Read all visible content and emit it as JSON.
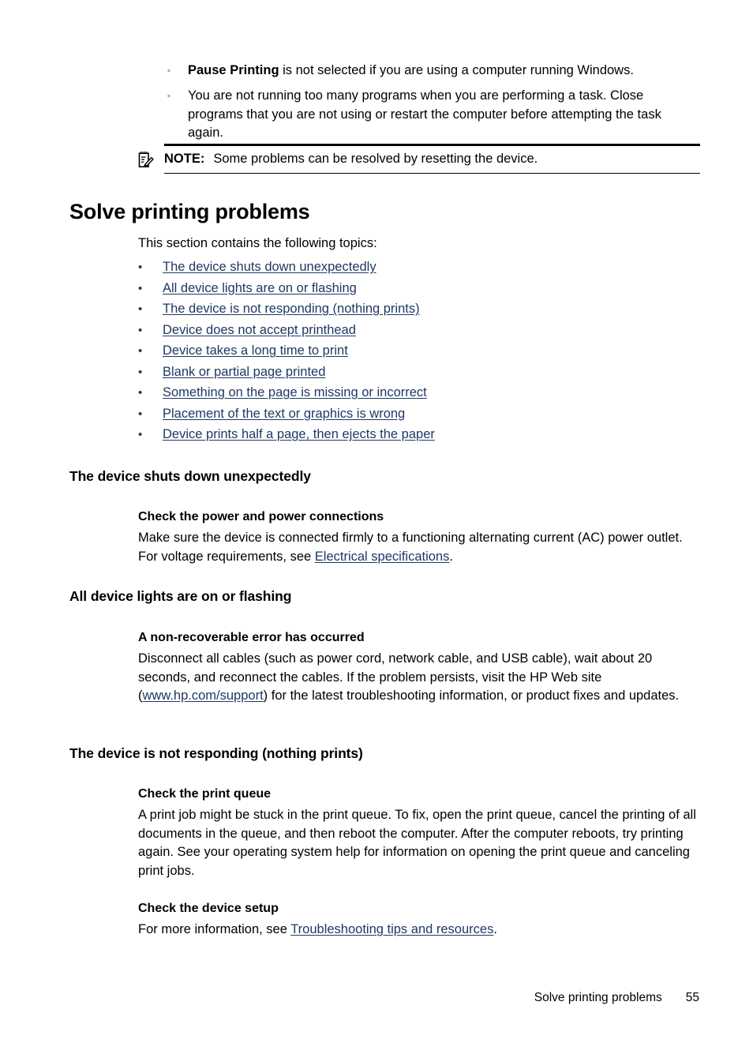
{
  "note_bullets": [
    {
      "marker": "◦",
      "bold_lead": "Pause Printing",
      "text": " is not selected if you are using a computer running Windows."
    },
    {
      "marker": "◦",
      "bold_lead": "",
      "text": "You are not running too many programs when you are performing a task. Close programs that you are not using or restart the computer before attempting the task again."
    }
  ],
  "note": {
    "icon": "note-pad-pencil-icon",
    "label": "NOTE:",
    "text": "Some problems can be resolved by resetting the device."
  },
  "heading": {
    "h1": "Solve printing problems"
  },
  "intro": "This section contains the following topics:",
  "topics": {
    "bullet": "•",
    "items": [
      "The device shuts down unexpectedly",
      "All device lights are on or flashing",
      "The device is not responding (nothing prints)",
      "Device does not accept printhead",
      "Device takes a long time to print",
      "Blank or partial page printed",
      "Something on the page is missing or incorrect",
      "Placement of the text or graphics is wrong",
      "Device prints half a page, then ejects the paper"
    ]
  },
  "sections": [
    {
      "title": "The device shuts down unexpectedly",
      "sub_title": "Check the power and power connections",
      "para_before": "Make sure the device is connected firmly to a functioning alternating current (AC) power outlet. For voltage requirements, see ",
      "link": "Electrical specifications",
      "para_after": "."
    },
    {
      "title": "All device lights are on or flashing",
      "sub_title": "A non-recoverable error has occurred",
      "para_before": "Disconnect all cables (such as power cord, network cable, and USB cable), wait about 20 seconds, and reconnect the cables. If the problem persists, visit the HP Web site (",
      "link": "www.hp.com/support",
      "para_after": ") for the latest troubleshooting information, or product fixes and updates."
    },
    {
      "title": "The device is not responding (nothing prints)",
      "sub_title": "Check the print queue",
      "para_before": "A print job might be stuck in the print queue. To fix, open the print queue, cancel the printing of all documents in the queue, and then reboot the computer. After the computer reboots, try printing again. See your operating system help for information on opening the print queue and canceling print jobs.",
      "link": "",
      "para_after": "",
      "sub_title2": "Check the device setup",
      "para2_before": "For more information, see ",
      "link2": "Troubleshooting tips and resources",
      "para2_after": "."
    }
  ],
  "footer": {
    "chapter": "Solve printing problems",
    "page_number": "55"
  },
  "colors": {
    "link": "#1F3864",
    "text": "#000000",
    "background": "#FFFFFF"
  }
}
